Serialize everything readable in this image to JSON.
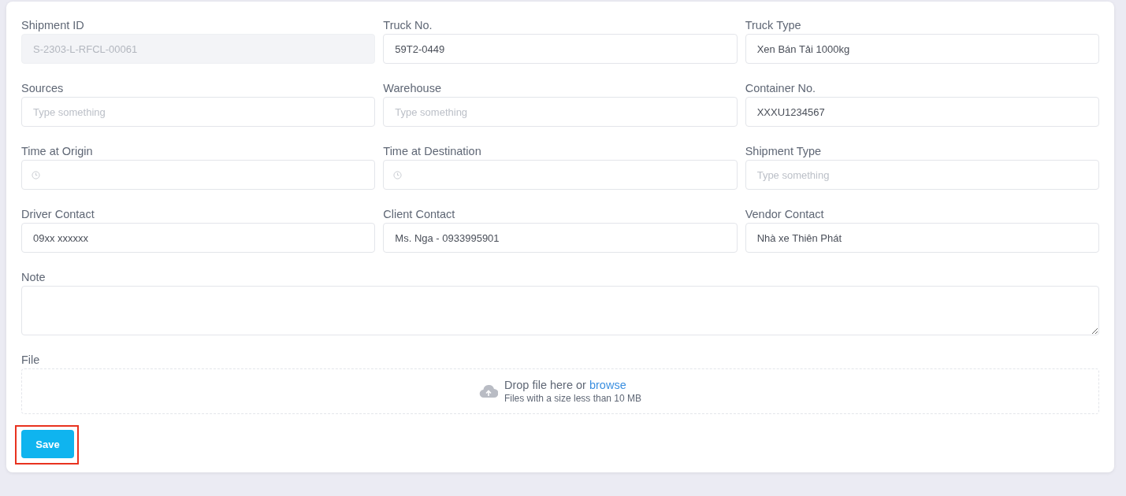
{
  "fields": [
    {
      "label": "Shipment ID",
      "kind": "text",
      "value": "S-2303-L-RFCL-00061",
      "disabled": true
    },
    {
      "label": "Truck No.",
      "kind": "text",
      "value": "59T2-0449",
      "disabled": false
    },
    {
      "label": "Truck Type",
      "kind": "text",
      "value": "Xen Bán Tải 1000kg",
      "disabled": false
    },
    {
      "label": "Sources",
      "kind": "text",
      "placeholder": "Type something",
      "disabled": false
    },
    {
      "label": "Warehouse",
      "kind": "text",
      "placeholder": "Type something",
      "disabled": false
    },
    {
      "label": "Container No.",
      "kind": "text",
      "value": "XXXU1234567",
      "disabled": false
    },
    {
      "label": "Time at Origin",
      "kind": "time",
      "disabled": false
    },
    {
      "label": "Time at Destination",
      "kind": "time",
      "disabled": false
    },
    {
      "label": "Shipment Type",
      "kind": "text",
      "placeholder": "Type something",
      "disabled": false
    },
    {
      "label": "Driver Contact",
      "kind": "text",
      "value": "09xx xxxxxx",
      "disabled": false
    },
    {
      "label": "Client Contact",
      "kind": "text",
      "value": "Ms. Nga - 0933995901",
      "disabled": false
    },
    {
      "label": "Vendor Contact",
      "kind": "text",
      "value": "Nhà xe Thiên Phát",
      "disabled": false
    }
  ],
  "note": {
    "label": "Note"
  },
  "file": {
    "label": "File",
    "prompt": "Drop file here or",
    "link": "browse",
    "hint": "Files with a size less than 10 MB"
  },
  "save": {
    "label": "Save",
    "highlighted": true
  }
}
